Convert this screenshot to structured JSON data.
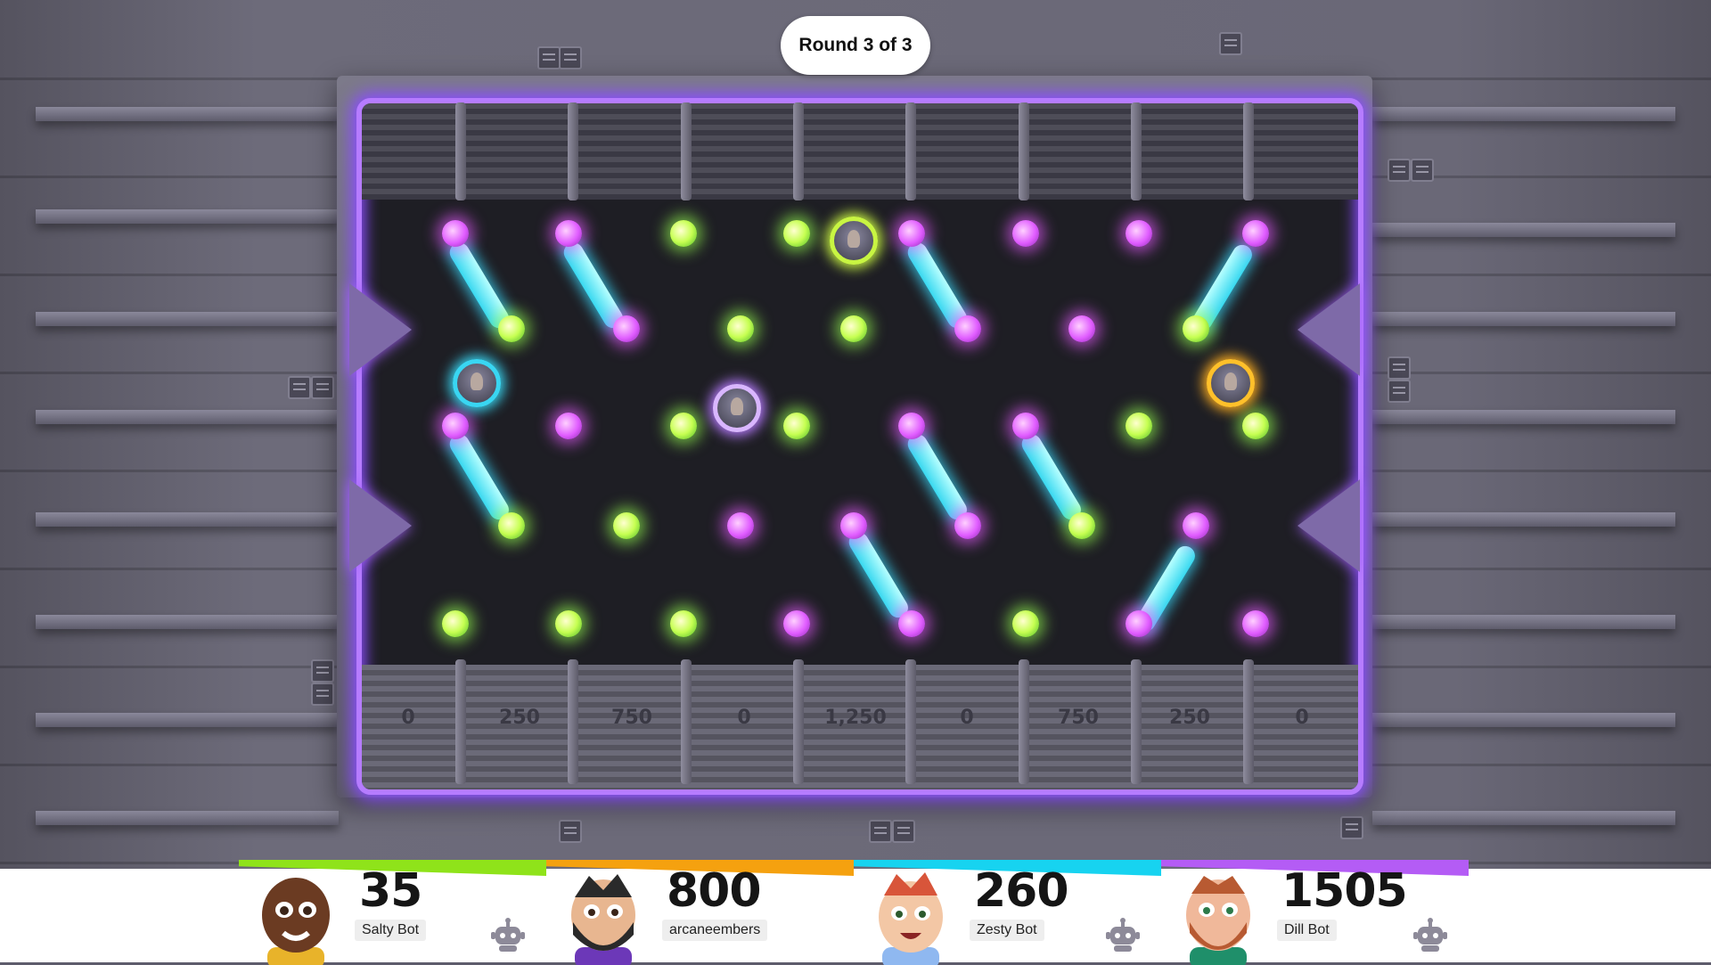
{
  "round_label": "Round 3 of 3",
  "slot_scores": [
    "0",
    "250",
    "750",
    "0",
    "1,250",
    "0",
    "750",
    "250",
    "0"
  ],
  "players": [
    {
      "score": "35",
      "name": "Salty Bot",
      "color": "#8fe31a",
      "is_bot": true,
      "icon": "robot-icon"
    },
    {
      "score": "800",
      "name": "arcaneembers",
      "color": "#f5a10f",
      "is_bot": false
    },
    {
      "score": "260",
      "name": "Zesty Bot",
      "color": "#17d3f0",
      "is_bot": true,
      "icon": "robot-icon"
    },
    {
      "score": "1505",
      "name": "Dill Bot",
      "color": "#b45cf5",
      "is_bot": true,
      "icon": "robot-icon"
    }
  ],
  "colors": {
    "board_glow": "#a663ff",
    "peg_pink": "#e05cff",
    "peg_green": "#c6ff52",
    "bar_cyan": "#38d8f0"
  }
}
